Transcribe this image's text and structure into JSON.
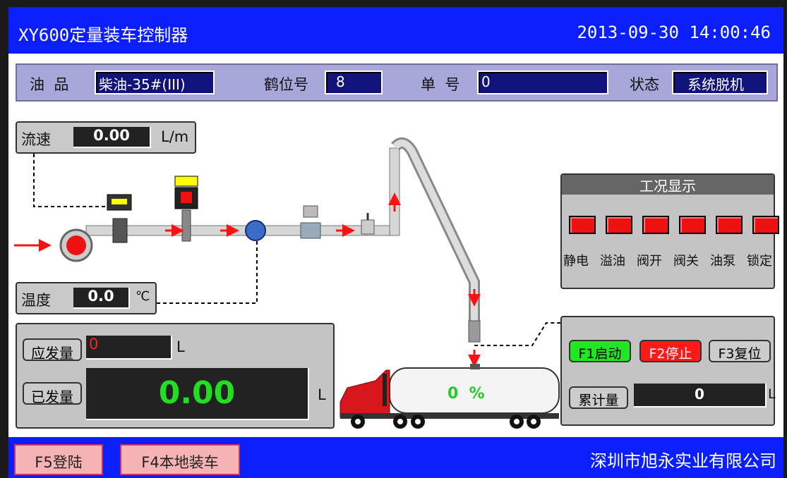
{
  "title": "XY600定量装车控制器",
  "datetime": "2013-09-30 14:00:46",
  "info": {
    "oil_label": "油  品",
    "oil_value": "柴油-35#(III)",
    "crane_label": "鹤位号",
    "crane_value": "8",
    "order_label": "单  号",
    "order_value": "0",
    "status_label": "状态",
    "status_value": "系统脱机"
  },
  "flow": {
    "label": "流速",
    "value": "0.00",
    "unit": "L/m"
  },
  "temp": {
    "label": "温度",
    "value": "0.0",
    "unit": "℃"
  },
  "volume": {
    "planned_label": "应发量",
    "planned_value": "0",
    "planned_unit": "L",
    "loaded_label": "已发量",
    "loaded_value": "0.00",
    "loaded_unit": "L"
  },
  "tank_percent": "0  %",
  "status_panel": {
    "title": "工况显示",
    "items": [
      "静电",
      "溢油",
      "阀开",
      "阀关",
      "油泵",
      "锁定"
    ]
  },
  "controls": {
    "start": "F1启动",
    "stop": "F2停止",
    "reset": "F3复位",
    "total_label": "累计量",
    "total_value": "0",
    "total_unit": "L"
  },
  "footer": {
    "login": "F5登陆",
    "local": "F4本地装车",
    "company": "深圳市旭永实业有限公司"
  },
  "colors": {
    "title_bar": "#0b1ffc",
    "led_red": "#e11111",
    "start_green": "#22e622",
    "stop_red": "#ff1a1a",
    "value_green": "#22dd22"
  }
}
